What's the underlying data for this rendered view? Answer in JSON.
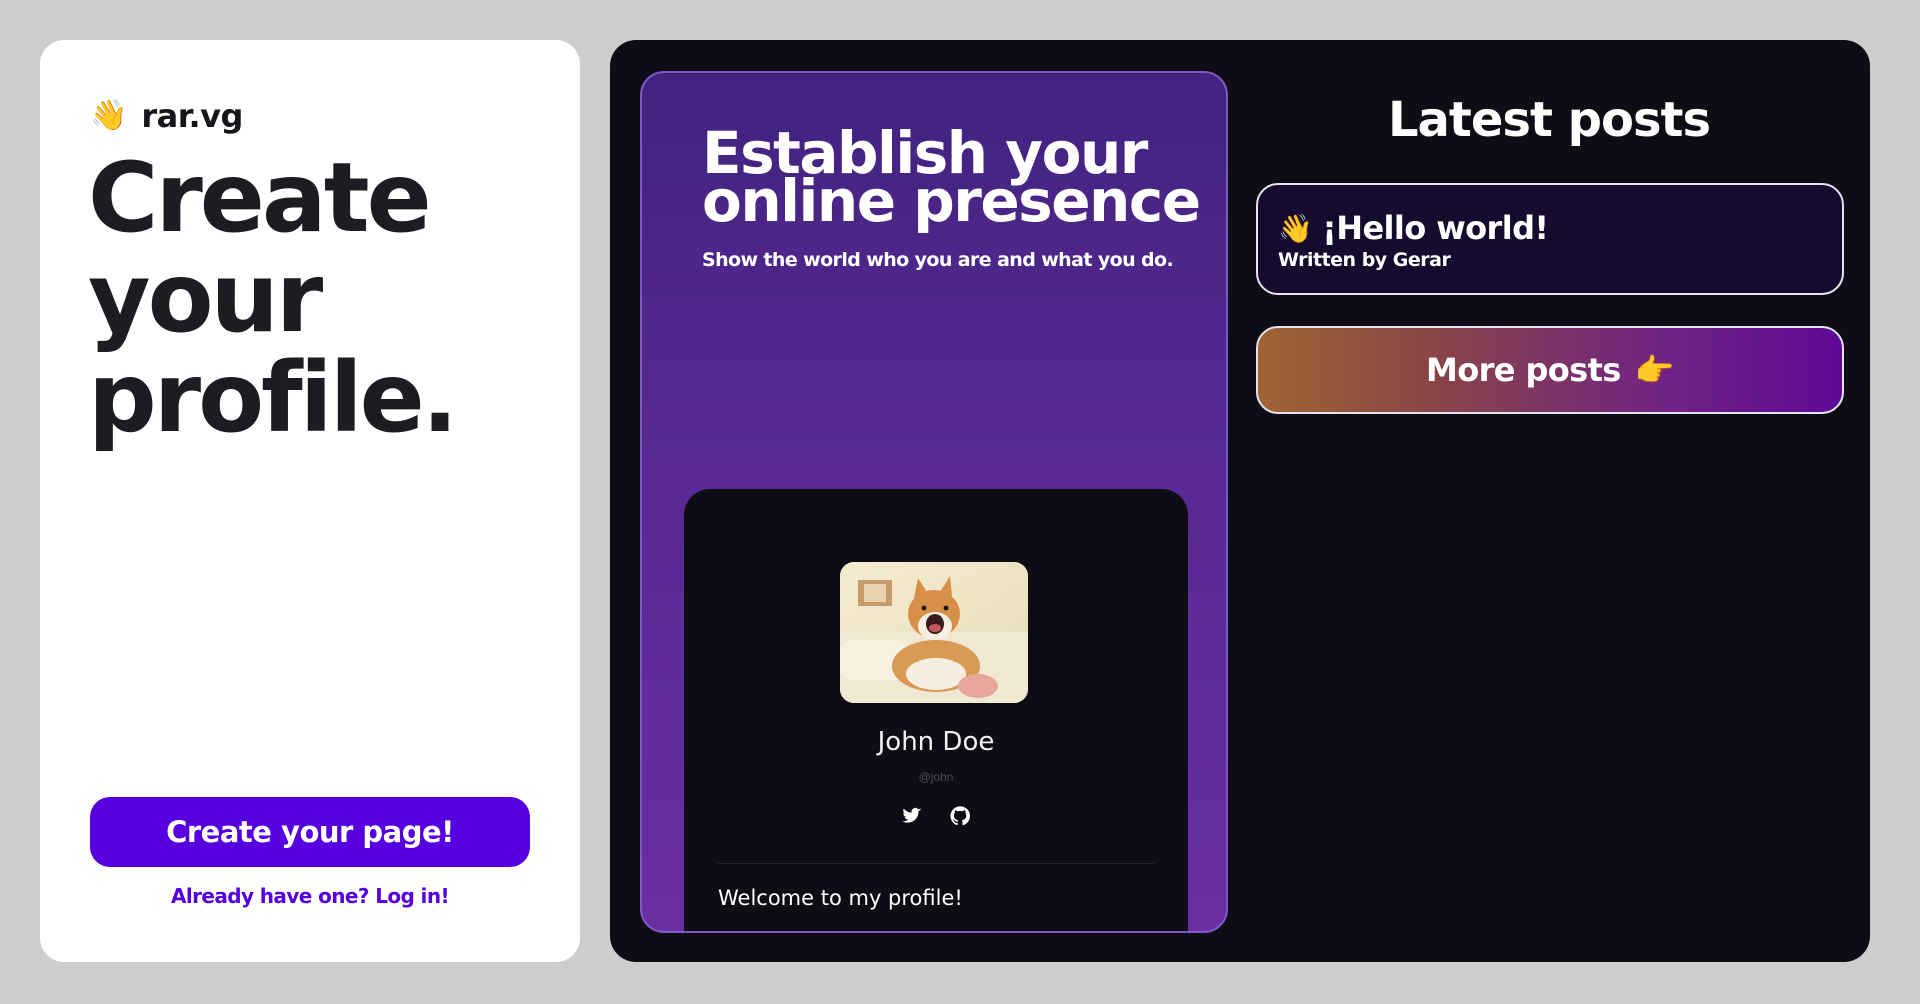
{
  "brand": {
    "icon": "waving-hand",
    "icon_glyph": "👋",
    "name": "rar.vg"
  },
  "hero": {
    "title_lines": [
      "Create",
      "your",
      "profile."
    ]
  },
  "cta": {
    "label": "Create your page!",
    "login_text": "Already have one? Log in!"
  },
  "promo": {
    "title_lines": [
      "Establish your",
      "online presence"
    ],
    "subtitle": "Show the world who you are and what you do.",
    "preview": {
      "name": "John Doe",
      "handle": "@john",
      "socials": [
        "twitter-icon",
        "github-icon"
      ],
      "welcome": "Welcome to my profile!"
    }
  },
  "posts": {
    "heading": "Latest posts",
    "items": [
      {
        "icon": "waving-hand",
        "icon_glyph": "👋",
        "title": "¡Hello world!",
        "author": "Written by Gerar"
      }
    ],
    "more_label": "More posts",
    "more_icon": "pointing-right-hand",
    "more_glyph": "👉"
  },
  "colors": {
    "accent": "#5600e0",
    "page_bg": "#cdcdcd",
    "dark_panel": "#0e0d16",
    "promo_purple": "#54288f"
  }
}
